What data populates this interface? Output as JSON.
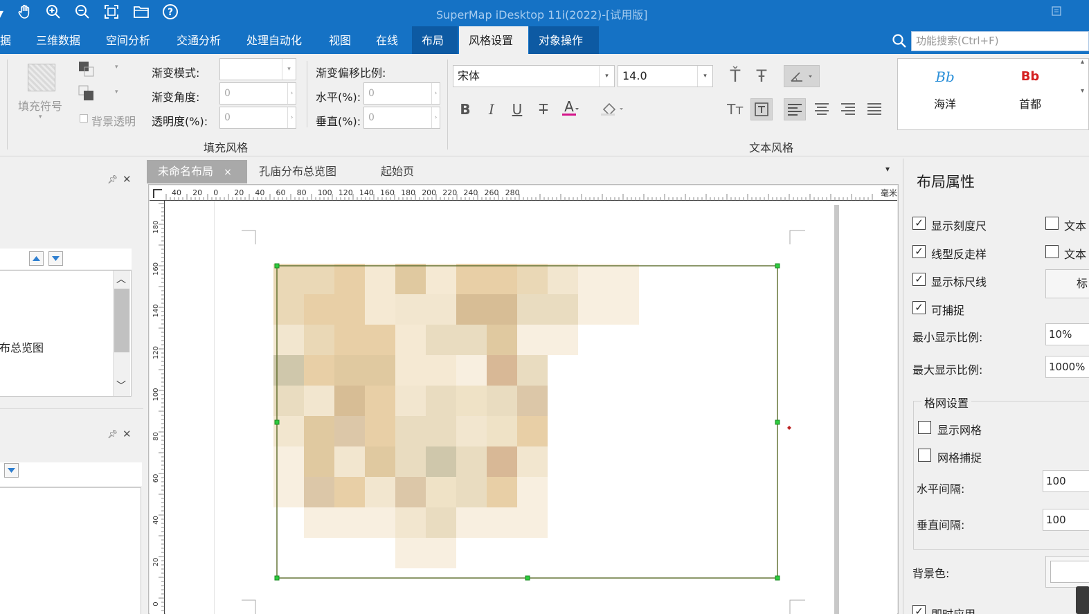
{
  "title_bar": {
    "title": "SuperMap iDesktop 11i(2022)-[试用版]",
    "icons": [
      "pan-hand-icon",
      "zoom-in-icon",
      "zoom-out-icon",
      "full-extent-icon",
      "open-folder-icon",
      "help-icon"
    ]
  },
  "menu": {
    "items": [
      "据",
      "三维数据",
      "空间分析",
      "交通分析",
      "处理自动化",
      "视图",
      "在线",
      "布局",
      "风格设置",
      "对象操作"
    ],
    "search_placeholder": "功能搜索(Ctrl+F)"
  },
  "ribbon": {
    "fill_symbol_label": "填充符号",
    "bg_transparent_label": "背景透明",
    "gradient_mode_label": "渐变模式:",
    "gradient_angle_label": "渐变角度:",
    "gradient_angle_value": "0",
    "transparency_label": "透明度(%):",
    "transparency_value": "0",
    "gradient_offset_label": "渐变偏移比例:",
    "horizontal_label": "水平(%):",
    "horizontal_value": "0",
    "vertical_label": "垂直(%):",
    "vertical_value": "0",
    "fill_group_title": "填充风格",
    "font_name": "宋体",
    "font_size": "14.0",
    "text_group_title": "文本风格",
    "styles": [
      {
        "sample": "Bb",
        "name": "海洋",
        "color": "#2a8fd8"
      },
      {
        "sample": "Bb",
        "name": "首都",
        "color": "#d42020"
      }
    ]
  },
  "left_pane": {
    "list_item": "布总览图"
  },
  "doc_tabs": [
    {
      "label": "未命名布局",
      "close": "×"
    },
    {
      "label": "孔庙分布总览图"
    },
    {
      "label": "起始页"
    }
  ],
  "ruler": {
    "unit": "毫米",
    "h_ticks": [
      "40",
      "20",
      "0",
      "20",
      "40",
      "60",
      "80",
      "100",
      "120",
      "140",
      "160",
      "180",
      "200",
      "220",
      "240",
      "260",
      "280"
    ],
    "v_ticks": [
      "180",
      "160",
      "140",
      "120",
      "100",
      "80",
      "60",
      "40",
      "20",
      "0"
    ]
  },
  "props": {
    "title": "布局属性",
    "show_ruler": "显示刻度尺",
    "line_antialias": "线型反走样",
    "show_guides": "显示标尺线",
    "snappable": "可捕捉",
    "text_a": "文本",
    "text_b": "文本",
    "min_scale_label": "最小显示比例:",
    "min_scale_value": "10%",
    "max_scale_label": "最大显示比例:",
    "max_scale_value": "1000%",
    "grid_group": "格网设置",
    "show_grid": "显示网格",
    "grid_snap": "网格捕捉",
    "h_spacing_label": "水平间隔:",
    "h_spacing_value": "100",
    "v_spacing_label": "垂直间隔:",
    "v_spacing_value": "100",
    "bg_color_label": "背景色:",
    "apply_now": "即时应用",
    "button_partial": "标"
  }
}
